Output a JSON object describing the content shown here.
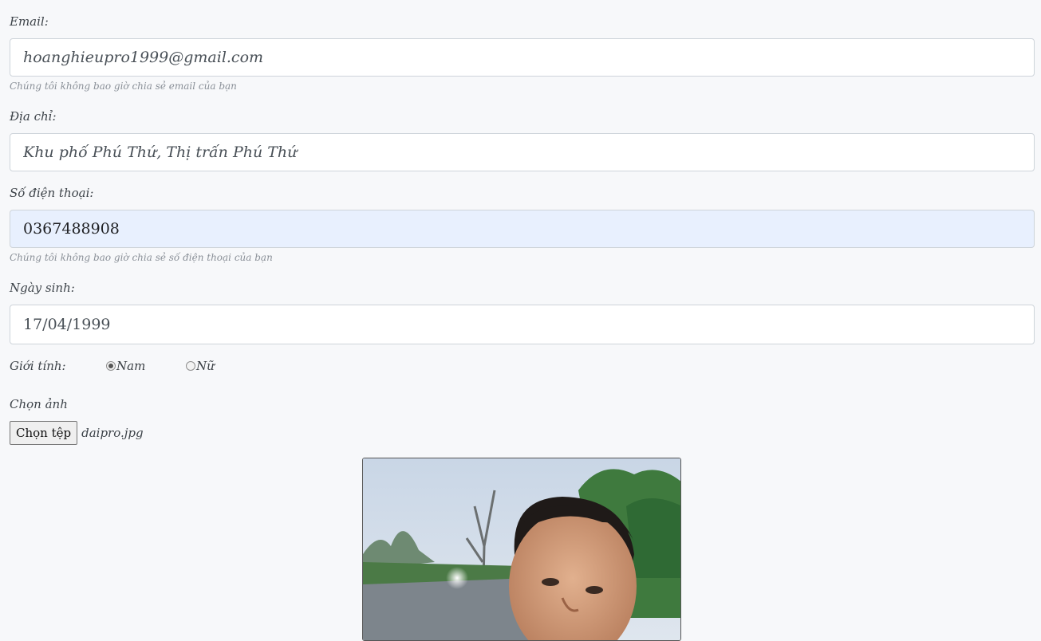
{
  "form": {
    "email": {
      "label": "Email:",
      "value": "hoanghieupro1999@gmail.com",
      "help": "Chúng tôi không bao giờ chia sẻ email của bạn"
    },
    "address": {
      "label": "Địa chỉ:",
      "value": "Khu phố Phú Thứ, Thị trấn Phú Thứ"
    },
    "phone": {
      "label": "Số điện thoại:",
      "value": "0367488908",
      "help": "Chúng tôi không bao giờ chia sẻ số điện thoại của bạn"
    },
    "birthday": {
      "label": "Ngày sinh:",
      "value": "17/04/1999"
    },
    "gender": {
      "label": "Giới tính:",
      "options": [
        "Nam",
        "Nữ"
      ],
      "selected": "Nam"
    },
    "photo": {
      "label": "Chọn ảnh",
      "button": "Chọn tệp",
      "filename": "daipro.jpg"
    }
  },
  "colors": {
    "background": "#f7f8fa",
    "input_border": "#ced4da",
    "autofill_bg": "#e8f0fe"
  }
}
